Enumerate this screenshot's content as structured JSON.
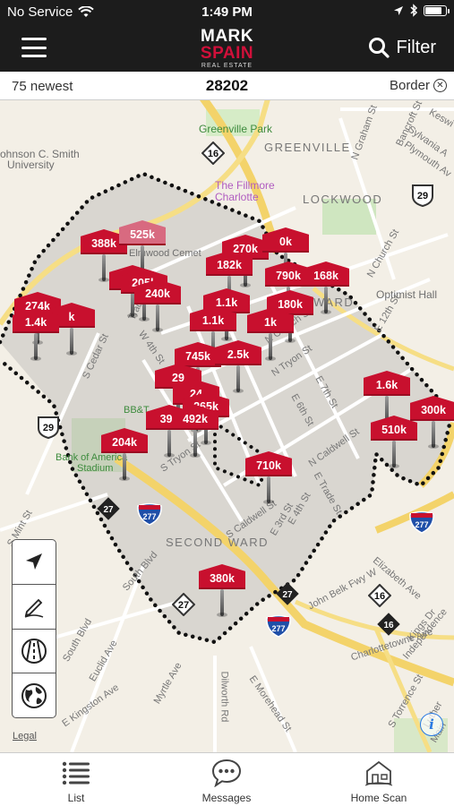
{
  "status": {
    "carrier": "No Service",
    "time": "1:49 PM"
  },
  "nav": {
    "logo_line1": "MARK",
    "logo_line2": "SPAIN",
    "logo_line3": "REAL ESTATE",
    "filter_label": "Filter",
    "menu_icon": "hamburger-icon",
    "filter_icon": "search-icon"
  },
  "infobar": {
    "count_label": "75 newest",
    "zip": "28202",
    "border_label": "Border"
  },
  "map": {
    "areas": {
      "greenville": "GREENVILLE",
      "lockwood": "LOCKWOOD",
      "second_ward": "SECOND WARD",
      "ward": "WARD"
    },
    "places": {
      "greenville_park": "Greenville Park",
      "fillmore_1": "The Fillmore",
      "fillmore_2": "Charlotte",
      "jcsu_1": "ohnson C. Smith",
      "jcsu_2": "University",
      "elmwood": "Elmwood Cemet",
      "optimist": "Optimist Hall",
      "bbt": "BB&T",
      "boa_1": "Bank of America",
      "boa_2": "Stadium"
    },
    "streets": {
      "graham": "N Graham St",
      "bancroft": "Bancroft St",
      "sylvania": "Sylvania A",
      "plymouth": "Plymouth Av",
      "keswick": "Keswi",
      "church_n": "N Church St",
      "twelfth": "E 12th St",
      "trade": "Trade St",
      "w4th": "W 4th St",
      "cedar": "S Cedar St",
      "n_tryon": "N Tryon St",
      "n_church2": "N Church St",
      "e6th": "E 6th St",
      "e7th": "E 7th St",
      "n_caldwell": "N Caldwell St",
      "s_tryon": "S Tryon St",
      "s_caldwell": "S Caldwell St",
      "e3rd": "E 3rd St",
      "e4th": "E 4th St",
      "e_trade": "E Trade St",
      "s_mint": "S Mint St",
      "south_blvd": "South Blvd",
      "south_blvd2": "South Blvd",
      "euclid": "Euclid Ave",
      "kingston": "E Kingston Ave",
      "myrtle": "Myrtle Ave",
      "dilworth": "Dilworth Rd",
      "morehead": "E Morehead St",
      "elizabeth": "Elizabeth Ave",
      "john_belk": "John Belk Fwy W",
      "charlottetowne": "Charlottetowne Ave",
      "independence": "Independence",
      "kings": "Kings Dr",
      "torrence": "S Torrence St",
      "luther": "Luther",
      "main": "Main"
    },
    "shields": {
      "r16a": "16",
      "r16b": "16",
      "r16c": "16",
      "r29": "29",
      "r29w": "29",
      "r27a": "27",
      "r27b": "27",
      "r27c": "27",
      "i277a": "277",
      "i277b": "277",
      "i277c": "277"
    },
    "pins": [
      {
        "label": "388k"
      },
      {
        "label": "525k"
      },
      {
        "label": "270k"
      },
      {
        "label": "0k"
      },
      {
        "label": "182k"
      },
      {
        "label": "790k"
      },
      {
        "label": "168k"
      },
      {
        "label": "20"
      },
      {
        "label": "205k"
      },
      {
        "label": "240k"
      },
      {
        "label": "274k"
      },
      {
        "label": "1.4k"
      },
      {
        "label": "k"
      },
      {
        "label": "1.1k"
      },
      {
        "label": "180k"
      },
      {
        "label": "1k"
      },
      {
        "label": "745k"
      },
      {
        "label": "2.5k"
      },
      {
        "label": "29"
      },
      {
        "label": "24"
      },
      {
        "label": "265k"
      },
      {
        "label": "399"
      },
      {
        "label": "492k"
      },
      {
        "label": "204k"
      },
      {
        "label": "710k"
      },
      {
        "label": "1.6k"
      },
      {
        "label": "510k"
      },
      {
        "label": "300k"
      },
      {
        "label": "380k"
      }
    ],
    "legal": "Legal",
    "info_glyph": "i"
  },
  "tabs": [
    {
      "label": "List",
      "icon": "list-icon"
    },
    {
      "label": "Messages",
      "icon": "messages-icon"
    },
    {
      "label": "Home Scan",
      "icon": "home-scan-icon"
    }
  ]
}
